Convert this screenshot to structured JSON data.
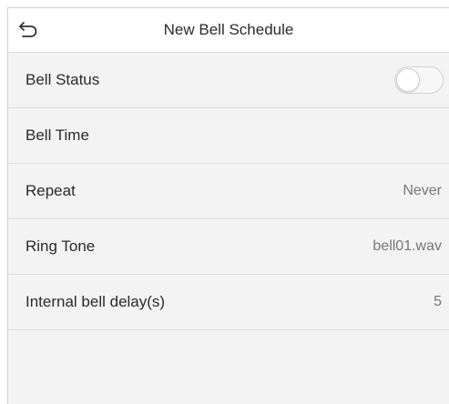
{
  "header": {
    "title": "New Bell Schedule",
    "back_icon": "back-arrow-icon"
  },
  "rows": [
    {
      "label": "Bell Status",
      "control": "toggle",
      "toggle_on": false
    },
    {
      "label": "Bell Time",
      "value": ""
    },
    {
      "label": "Repeat",
      "value": "Never"
    },
    {
      "label": "Ring Tone",
      "value": "bell01.wav"
    },
    {
      "label": "Internal bell delay(s)",
      "value": "5"
    }
  ],
  "colors": {
    "background": "#f3f3f3",
    "header_background": "#ffffff",
    "divider": "#dedede",
    "value_text": "#777777",
    "label_text": "#2a2a2a"
  }
}
